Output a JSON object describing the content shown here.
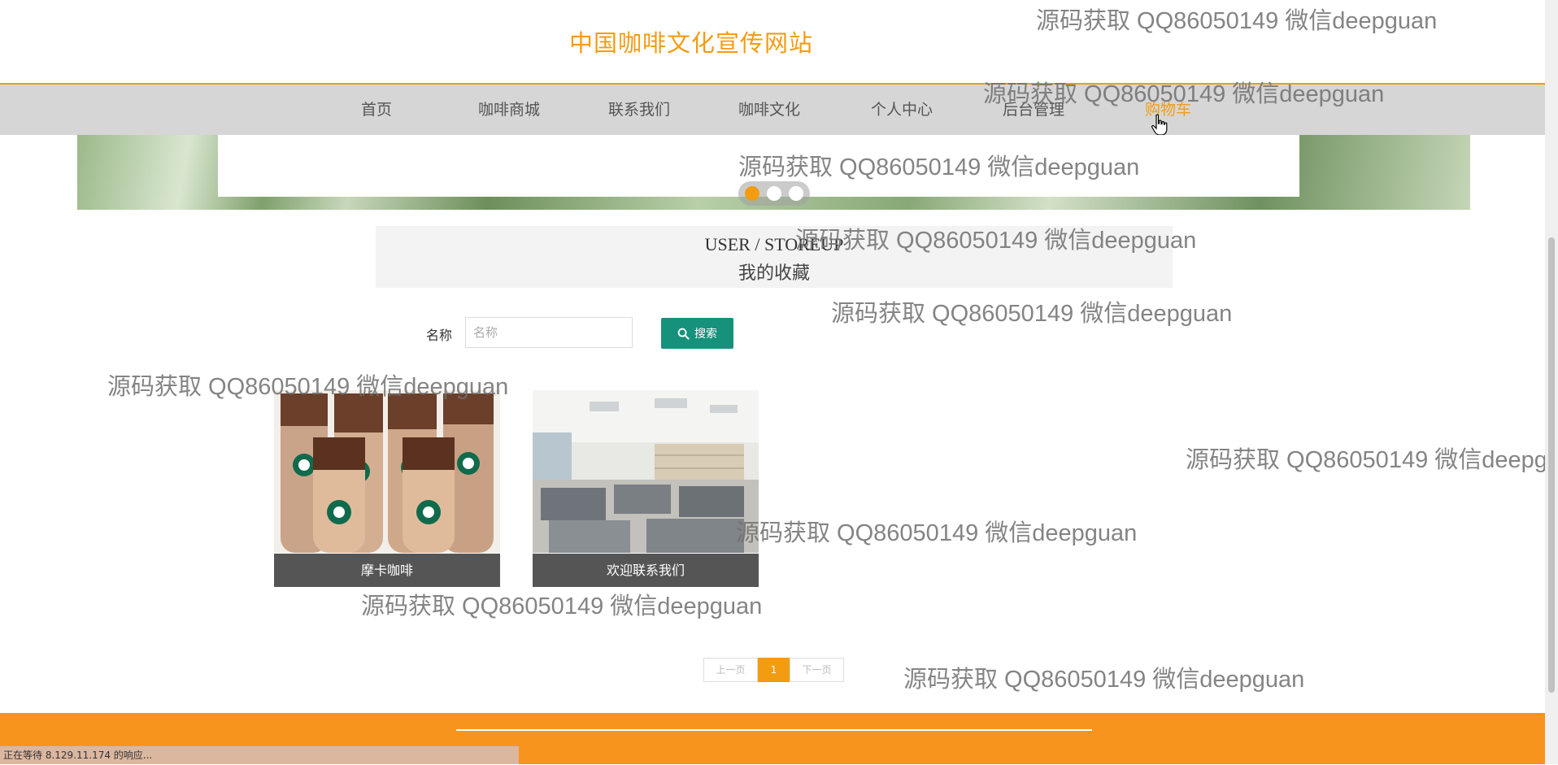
{
  "site": {
    "title": "中国咖啡文化宣传网站"
  },
  "nav": {
    "items": [
      {
        "label": "首页"
      },
      {
        "label": "咖啡商城"
      },
      {
        "label": "联系我们"
      },
      {
        "label": "咖啡文化"
      },
      {
        "label": "个人中心"
      },
      {
        "label": "后台管理"
      },
      {
        "label": "购物车",
        "active": true
      }
    ]
  },
  "carousel": {
    "slide_count": 3,
    "active_index": 0
  },
  "section": {
    "title_en": "USER / STOREUP",
    "title_cn": "我的收藏"
  },
  "search": {
    "label": "名称",
    "placeholder": "名称",
    "value": "",
    "button_label": "搜索"
  },
  "favorites": [
    {
      "name": "摩卡咖啡"
    },
    {
      "name": "欢迎联系我们"
    }
  ],
  "pagination": {
    "prev_label": "上一页",
    "current_page": "1",
    "next_label": "下一页"
  },
  "status_bar": {
    "text": "正在等待 8.129.11.174 的响应..."
  },
  "watermark": {
    "text": "源码获取 QQ86050149 微信deepguan"
  },
  "colors": {
    "accent": "#f39c12",
    "nav_bg": "#d6d6d6",
    "search_button": "#16917c",
    "caption_bg": "#555555",
    "footer": "#f7941d"
  }
}
